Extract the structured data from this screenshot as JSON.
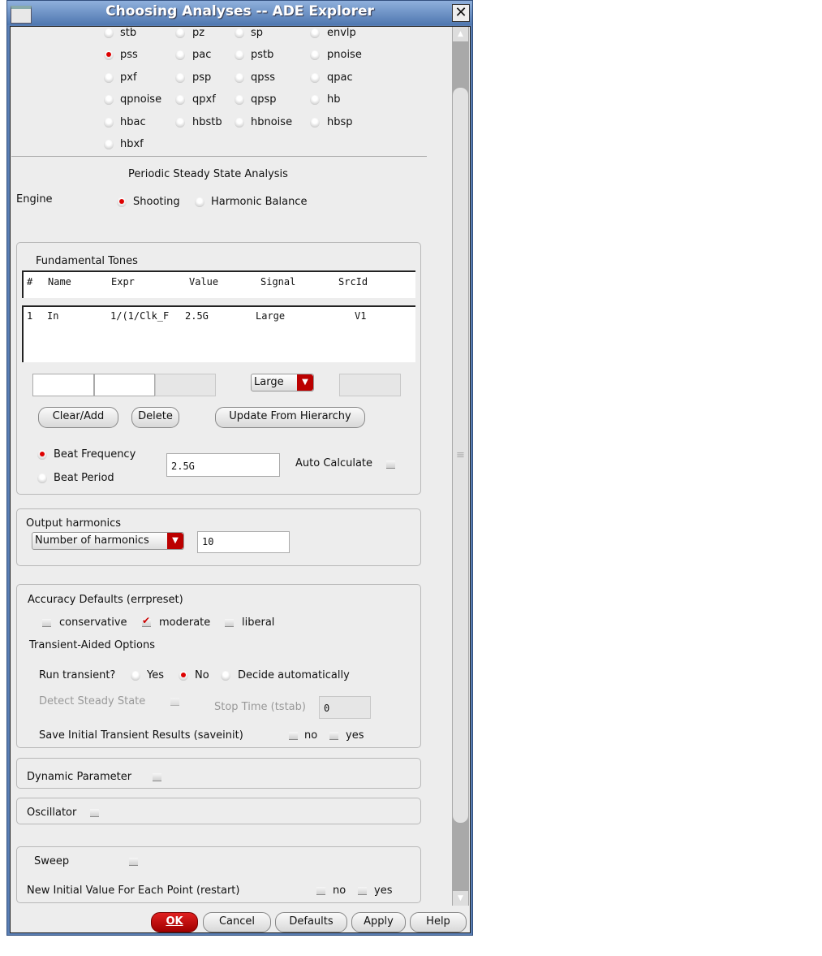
{
  "window": {
    "title": "Choosing Analyses -- ADE Explorer"
  },
  "analyses": [
    [
      {
        "label": "stb",
        "sel": false
      },
      {
        "label": "pz",
        "sel": false
      },
      {
        "label": "sp",
        "sel": false
      },
      {
        "label": "envlp",
        "sel": false
      }
    ],
    [
      {
        "label": "pss",
        "sel": true
      },
      {
        "label": "pac",
        "sel": false
      },
      {
        "label": "pstb",
        "sel": false
      },
      {
        "label": "pnoise",
        "sel": false
      }
    ],
    [
      {
        "label": "pxf",
        "sel": false
      },
      {
        "label": "psp",
        "sel": false
      },
      {
        "label": "qpss",
        "sel": false
      },
      {
        "label": "qpac",
        "sel": false
      }
    ],
    [
      {
        "label": "qpnoise",
        "sel": false
      },
      {
        "label": "qpxf",
        "sel": false
      },
      {
        "label": "qpsp",
        "sel": false
      },
      {
        "label": "hb",
        "sel": false
      }
    ],
    [
      {
        "label": "hbac",
        "sel": false
      },
      {
        "label": "hbstb",
        "sel": false
      },
      {
        "label": "hbnoise",
        "sel": false
      },
      {
        "label": "hbsp",
        "sel": false
      }
    ],
    [
      {
        "label": "hbxf",
        "sel": false
      }
    ]
  ],
  "section_title": "Periodic Steady State Analysis",
  "engine": {
    "label": "Engine",
    "options": [
      "Shooting",
      "Harmonic Balance"
    ],
    "selected": "Shooting"
  },
  "tones": {
    "title": "Fundamental Tones",
    "columns": [
      "#",
      "Name",
      "Expr",
      "Value",
      "Signal",
      "SrcId"
    ],
    "rows": [
      [
        "1",
        "In",
        "1/(1/Clk_F",
        "2.5G",
        "Large",
        "V1"
      ]
    ],
    "signal_select": "Large",
    "clear_add": "Clear/Add",
    "delete": "Delete",
    "update": "Update From Hierarchy",
    "beat_frequency": "Beat Frequency",
    "beat_period": "Beat Period",
    "beat_value": "2.5G",
    "auto_calculate": "Auto Calculate"
  },
  "harmonics": {
    "title": "Output harmonics",
    "select": "Number of harmonics",
    "value": "10"
  },
  "accuracy": {
    "title": "Accuracy Defaults (errpreset)",
    "options": [
      "conservative",
      "moderate",
      "liberal"
    ],
    "selected": "moderate",
    "transient_title": "Transient-Aided Options",
    "run_transient": "Run transient?",
    "run_options": [
      "Yes",
      "No",
      "Decide automatically"
    ],
    "run_selected": "No",
    "detect_steady": "Detect Steady State",
    "stop_time": "Stop Time (tstab)",
    "stop_value": "0",
    "saveinit": "Save Initial Transient Results (saveinit)",
    "no": "no",
    "yes": "yes"
  },
  "dynamic_parameter": "Dynamic Parameter",
  "oscillator": "Oscillator",
  "sweep": {
    "label": "Sweep",
    "restart": "New Initial Value For Each Point (restart)",
    "no": "no",
    "yes": "yes"
  },
  "buttons": {
    "ok": "OK",
    "cancel": "Cancel",
    "defaults": "Defaults",
    "apply": "Apply",
    "help": "Help"
  },
  "colors": {
    "accent": "#bb0000",
    "titlebar": "#5a7fb5"
  }
}
